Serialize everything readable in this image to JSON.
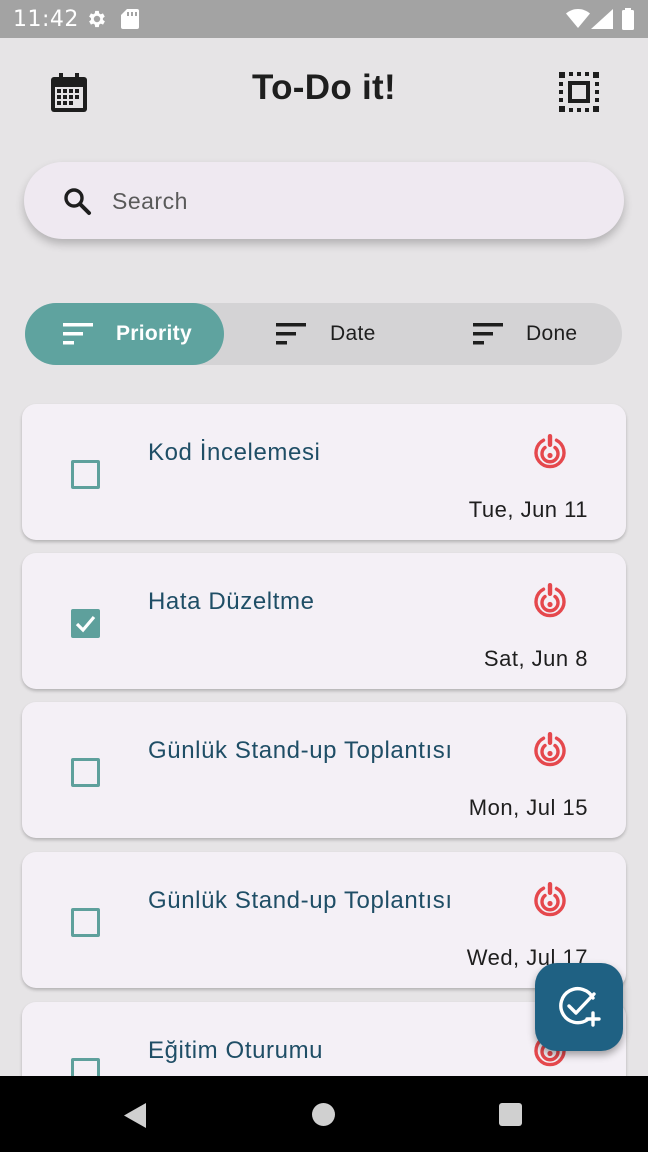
{
  "status_bar": {
    "time": "11:42",
    "icons": [
      "gear-icon",
      "sd-card-icon",
      "wifi-icon",
      "signal-icon",
      "battery-icon"
    ]
  },
  "app_bar": {
    "title": "To-Do it!",
    "left_icon": "calendar-icon",
    "right_icon": "select-all-icon"
  },
  "search": {
    "placeholder": "Search",
    "value": ""
  },
  "sort": {
    "options": [
      {
        "label": "Priority",
        "active": true
      },
      {
        "label": "Date",
        "active": false
      },
      {
        "label": "Done",
        "active": false
      }
    ]
  },
  "tasks": [
    {
      "title": "Kod İncelemesi",
      "date": "Tue, Jun 11",
      "done": false
    },
    {
      "title": "Hata Düzeltme",
      "date": "Sat, Jun 8",
      "done": true
    },
    {
      "title": "Günlük Stand-up Toplantısı",
      "date": "Mon, Jul 15",
      "done": false
    },
    {
      "title": "Günlük Stand-up Toplantısı",
      "date": "Wed, Jul 17",
      "done": false
    },
    {
      "title": "Eğitim Oturumu",
      "date": "",
      "done": false
    }
  ],
  "fab": {
    "icon": "add-task-icon"
  },
  "colors": {
    "accent": "#5fa39f",
    "fab": "#1f6183",
    "priority": "#e5484d",
    "title_text": "#1f4e66"
  }
}
